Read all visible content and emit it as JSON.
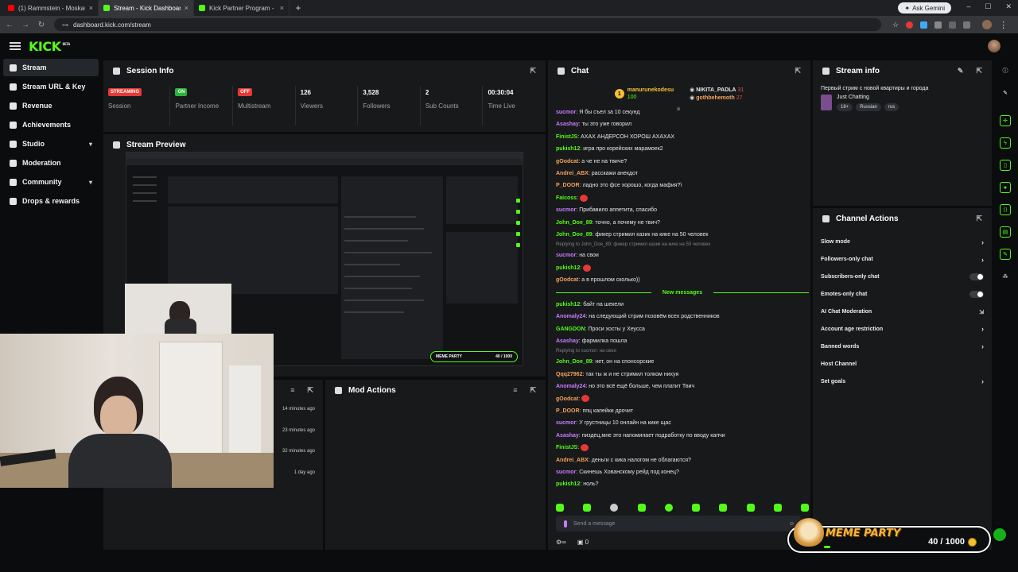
{
  "browser": {
    "tabs": [
      {
        "title": "(1) Rammstein - Moskau (Offici",
        "color": "#ff0000"
      },
      {
        "title": "Stream - Kick Dashboard",
        "color": "#53fc18"
      },
      {
        "title": "Kick Partner Program - Kick Da",
        "color": "#53fc18"
      }
    ],
    "url": "dashboard.kick.com/stream",
    "gemini_label": "Ask Gemini"
  },
  "header": {
    "logo": "KICK",
    "logo_tag": "BETA"
  },
  "sidebar": {
    "items": [
      {
        "label": "Stream",
        "active": true
      },
      {
        "label": "Stream URL & Key"
      },
      {
        "label": "Revenue"
      },
      {
        "label": "Achievements"
      },
      {
        "label": "Studio",
        "chevron": true
      },
      {
        "label": "Moderation"
      },
      {
        "label": "Community",
        "chevron": true
      },
      {
        "label": "Drops & rewards"
      }
    ]
  },
  "session": {
    "title": "Session Info",
    "stats": [
      {
        "badge": "STREAMING",
        "badge_color": "#e53935",
        "label": "Session"
      },
      {
        "badge": "ON",
        "badge_color": "#2bb43a",
        "label": "Partner Income"
      },
      {
        "badge": "OFF",
        "badge_color": "#e53935",
        "label": "Multistream"
      },
      {
        "num": "126",
        "label": "Viewers"
      },
      {
        "num": "3,528",
        "label": "Followers"
      },
      {
        "num": "2",
        "label": "Sub Counts"
      },
      {
        "num": "00:30:04",
        "label": "Time Live"
      }
    ]
  },
  "preview": {
    "title": "Stream Preview",
    "meme_label": "MEME PARTY",
    "meme_count": "40 / 1000"
  },
  "recent": {
    "times": [
      "14 minutes ago",
      "23 minutes ago",
      "32 minutes ago",
      "1 day ago"
    ]
  },
  "modactions": {
    "title": "Mod Actions"
  },
  "chat": {
    "title": "Chat",
    "top": {
      "left_user": "manurunekodesu",
      "left_val": "100",
      "right": [
        {
          "user": "NIKITA_PADLA",
          "val": "31"
        },
        {
          "user": "gothbehemoth",
          "val": "27"
        }
      ]
    },
    "messages": [
      {
        "user": "sucmor",
        "color": "#c77dff",
        "text": "Я бы съел за 10 секунд"
      },
      {
        "user": "Asashay",
        "color": "#c77dff",
        "text": "ты это уже говорил"
      },
      {
        "user": "FinistJS",
        "color": "#53fc18",
        "text": "АХАХ АНДЕРСОН ХОРОШ АХАХАХ"
      },
      {
        "user": "pukish12",
        "color": "#53fc18",
        "text": "игра про корейских марамоек2"
      },
      {
        "user": "gOodcat",
        "color": "#f4a259",
        "text": "а че не на твиче?"
      },
      {
        "user": "Andrei_ABX",
        "color": "#f4a259",
        "text": "расскажи анекдот"
      },
      {
        "user": "P_DOOR",
        "color": "#f4a259",
        "text": "ладно это фсе хорошо, когда мафия?\\"
      },
      {
        "user": "Faicoss",
        "color": "#53fc18",
        "text": ""
      },
      {
        "user": "sucmor",
        "color": "#c77dff",
        "text": "Прибавило аппетита, спасибо"
      },
      {
        "user": "John_Doe_89",
        "color": "#53fc18",
        "text": "точно, а почему не твич?"
      },
      {
        "user": "John_Doe_89",
        "color": "#53fc18",
        "text": "фикер стримил казик на кике на 50 человек"
      },
      {
        "reply": "Replying to John_Doe_89: фикер стримил казик на кике на 50 человек"
      },
      {
        "user": "sucmor",
        "color": "#c77dff",
        "text": "на свои"
      },
      {
        "user": "pukish12",
        "color": "#53fc18",
        "text": ""
      },
      {
        "user": "gOodcat",
        "color": "#f4a259",
        "text": "а в прошлом сколько))"
      },
      {
        "divider": "New messages"
      },
      {
        "user": "pukish12",
        "color": "#53fc18",
        "text": "байт на шекели"
      },
      {
        "user": "Anomaly24",
        "color": "#c77dff",
        "text": "на следующий стрим позовём всех родственников"
      },
      {
        "user": "GANGDON",
        "color": "#53fc18",
        "text": "Проси хосты у Хеусса"
      },
      {
        "user": "Asashay",
        "color": "#c77dff",
        "text": "фармилка пошла"
      },
      {
        "reply": "Replying to sucmor: на свои"
      },
      {
        "user": "John_Doe_89",
        "color": "#53fc18",
        "text": "нет, он на спонсорские"
      },
      {
        "user": "Qqq27962",
        "color": "#f4a259",
        "text": "так ты ж и не стримил толком нихуя"
      },
      {
        "user": "Anomaly24",
        "color": "#c77dff",
        "text": "но это всё ещё больше, чем платит Твич"
      },
      {
        "user": "gOodcat",
        "color": "#f4a259",
        "text": ""
      },
      {
        "user": "P_DOOR",
        "color": "#f4a259",
        "text": "ппц капейки дрочит"
      },
      {
        "user": "sucmor",
        "color": "#c77dff",
        "text": "У грустницы 10 онлайн на кике щас"
      },
      {
        "user": "Asashay",
        "color": "#c77dff",
        "text": "пиздец,мне это напоминает подработку по вводу капчи"
      },
      {
        "user": "FinistJS",
        "color": "#53fc18",
        "text": ""
      },
      {
        "user": "Andrei_ABX",
        "color": "#f4a259",
        "text": "деньги с кика налогом не облагаются?"
      },
      {
        "user": "sucmor",
        "color": "#c77dff",
        "text": "Скинешь Хованскому рейд под конец?"
      },
      {
        "user": "pukish12",
        "color": "#53fc18",
        "text": "ноль?"
      }
    ],
    "placeholder": "Send a message",
    "bottom_left": "0"
  },
  "streaminfo": {
    "title": "Stream info",
    "stream_title": "Первый стрим с новой квартиры и города",
    "category": "Just Chatting",
    "tags": [
      "18+",
      "Russian",
      "rus"
    ]
  },
  "channel_actions": {
    "title": "Channel Actions",
    "items": [
      {
        "label": "Slow mode",
        "kind": "chevron"
      },
      {
        "label": "Followers-only chat",
        "kind": "chevron"
      },
      {
        "label": "Subscribers-only chat",
        "kind": "toggle"
      },
      {
        "label": "Emotes-only chat",
        "kind": "toggle"
      },
      {
        "label": "AI Chat Moderation",
        "kind": "external"
      },
      {
        "label": "Account age restriction",
        "kind": "chevron"
      },
      {
        "label": "Banned words",
        "kind": "chevron"
      },
      {
        "label": "Host Channel",
        "kind": "none"
      },
      {
        "label": "Set goals",
        "kind": "chevron"
      }
    ]
  },
  "overlay": {
    "label": "MEME PARTY",
    "count": "40 / 1000",
    "progress": 0.04
  },
  "colors": {
    "accent": "#53fc18",
    "panel": "#18191b",
    "bg": "#0b0c0d"
  }
}
